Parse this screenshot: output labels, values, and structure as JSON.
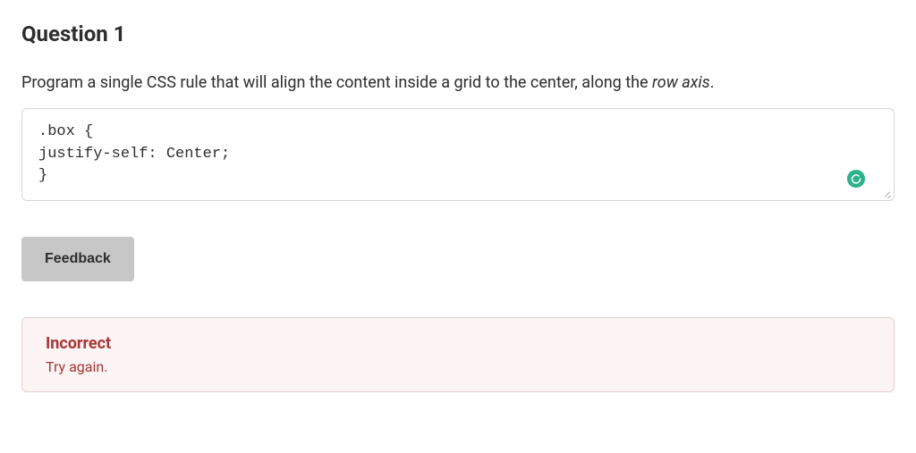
{
  "question": {
    "title": "Question 1",
    "prompt_before_italic": "Program a single CSS rule that will align the content inside a grid to the center, along the ",
    "prompt_italic": "row axis",
    "prompt_after_italic": "."
  },
  "code_input": {
    "value": ".box {\njustify-self: Center;\n}"
  },
  "buttons": {
    "feedback_label": "Feedback"
  },
  "feedback": {
    "status": "Incorrect",
    "message": "Try again."
  },
  "icons": {
    "grammarly": "grammarly-icon"
  }
}
